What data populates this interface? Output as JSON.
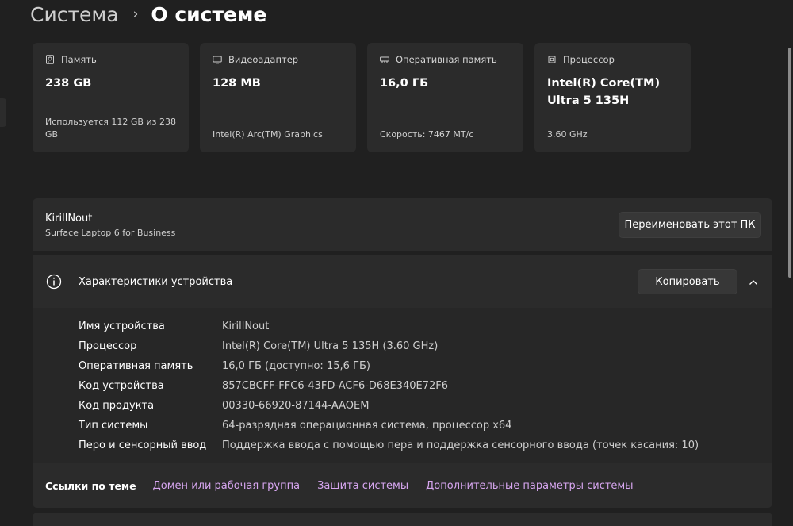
{
  "breadcrumb": {
    "parent": "Система",
    "separator": "›",
    "current": "О системе"
  },
  "cards": [
    {
      "icon": "storage-icon",
      "label": "Память",
      "value": "238 GB",
      "sub": "Используется 112 GB из 238 GB"
    },
    {
      "icon": "display-adapter-icon",
      "label": "Видеоадаптер",
      "value": "128 MB",
      "sub": "Intel(R) Arc(TM) Graphics"
    },
    {
      "icon": "ram-icon",
      "label": "Оперативная память",
      "value": "16,0 ГБ",
      "sub": "Скорость: 7467 MT/с"
    },
    {
      "icon": "cpu-icon",
      "label": "Процессор",
      "value": "Intel(R) Core(TM) Ultra 5 135H",
      "sub": "3.60 GHz"
    }
  ],
  "pc": {
    "name": "KirillNout",
    "model": "Surface Laptop 6 for Business",
    "rename_label": "Переименовать этот ПК"
  },
  "specs": {
    "title": "Характеристики устройства",
    "copy_label": "Копировать",
    "rows": [
      {
        "label": "Имя устройства",
        "value": "KirillNout"
      },
      {
        "label": "Процессор",
        "value": "Intel(R) Core(TM) Ultra 5 135H (3.60 GHz)"
      },
      {
        "label": "Оперативная память",
        "value": "16,0 ГБ (доступно: 15,6 ГБ)"
      },
      {
        "label": "Код устройства",
        "value": "857CBCFF-FFC6-43FD-ACF6-D68E340E72F6"
      },
      {
        "label": "Код продукта",
        "value": "00330-66920-87144-AAOEM"
      },
      {
        "label": "Тип системы",
        "value": "64-разрядная операционная система, процессор x64"
      },
      {
        "label": "Перо и сенсорный ввод",
        "value": "Поддержка ввода с помощью пера и поддержка сенсорного ввода (точек касания: 10)"
      }
    ]
  },
  "related": {
    "title": "Ссылки по теме",
    "links": [
      "Домен или рабочая группа",
      "Защита системы",
      "Дополнительные параметры системы"
    ]
  },
  "colors": {
    "background": "#202020",
    "card": "#2b2b2b",
    "link": "#d7a6f0"
  }
}
